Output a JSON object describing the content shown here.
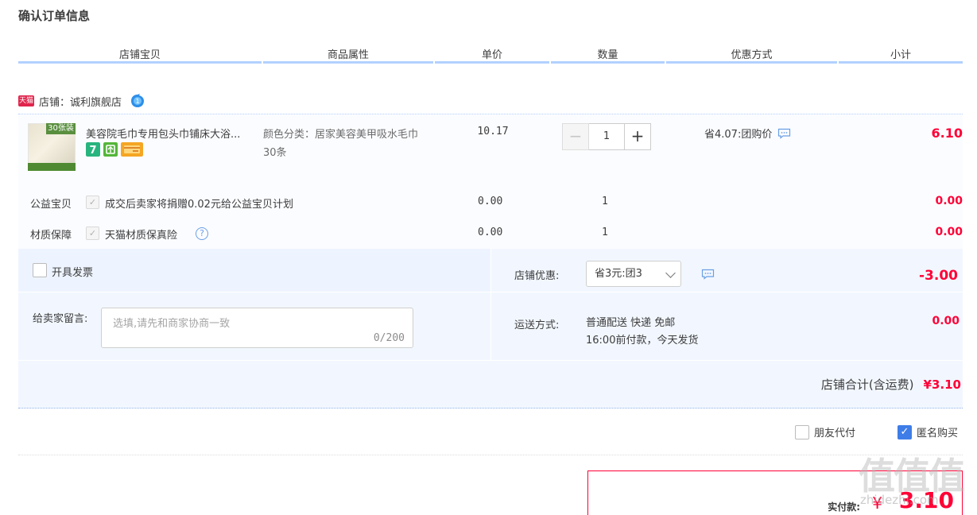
{
  "page": {
    "title": "确认订单信息"
  },
  "table_headers": [
    "店铺宝贝",
    "商品属性",
    "单价",
    "数量",
    "优惠方式",
    "小计"
  ],
  "shop": {
    "badge": "天猫",
    "label": "店铺：诚利旗舰店"
  },
  "item": {
    "thumb_tag": "30张装",
    "name": "美容院毛巾专用包头巾铺床大浴...",
    "prop_line1": "颜色分类：居家美容美甲吸水毛巾",
    "prop_line2": "30条",
    "unit_price": "10.17",
    "quantity": "1",
    "qty_minus": "−",
    "qty_plus": "+",
    "promo": "省4.07:团购价",
    "subtotal": "6.10"
  },
  "extras": [
    {
      "label": "公益宝贝",
      "text": "成交后卖家将捐赠0.02元给公益宝贝计划",
      "price": "0.00",
      "qty": "1",
      "subtotal": "0.00"
    },
    {
      "label": "材质保障",
      "text": "天猫材质保真险",
      "price": "0.00",
      "qty": "1",
      "subtotal": "0.00"
    }
  ],
  "options": {
    "invoice_label": "开具发票",
    "shop_discount_label": "店铺优惠:",
    "shop_discount_selected": "省3元:团3",
    "shop_discount_value": "-3.00",
    "memo_label": "给卖家留言:",
    "memo_placeholder": "选填,请先和商家协商一致",
    "memo_count": "0/200",
    "shipping_label": "运送方式:",
    "shipping_line1": "普通配送 快递 免邮",
    "shipping_line2": "16:00前付款，今天发货",
    "shipping_value": "0.00"
  },
  "shop_total": {
    "label": "店铺合计(含运费)",
    "value": "¥3.10"
  },
  "pay_options": {
    "friend_pay": "朋友代付",
    "anonymous": "匿名购买"
  },
  "payment": {
    "label": "实付款:",
    "currency": "¥",
    "value": "3.10"
  },
  "watermark": {
    "text": "值值值",
    "url": "zhidezhi.com"
  },
  "colors": {
    "accent_red": "#ff0036",
    "header_line": "#b2d1ff",
    "panel_bg": "#f2f7ff",
    "check_blue": "#3e7de8"
  },
  "icons": [
    "tmall-badge-icon",
    "wangwang-chat-icon",
    "message-icon",
    "help-icon",
    "checkbox-icon",
    "chevron-down-icon"
  ]
}
